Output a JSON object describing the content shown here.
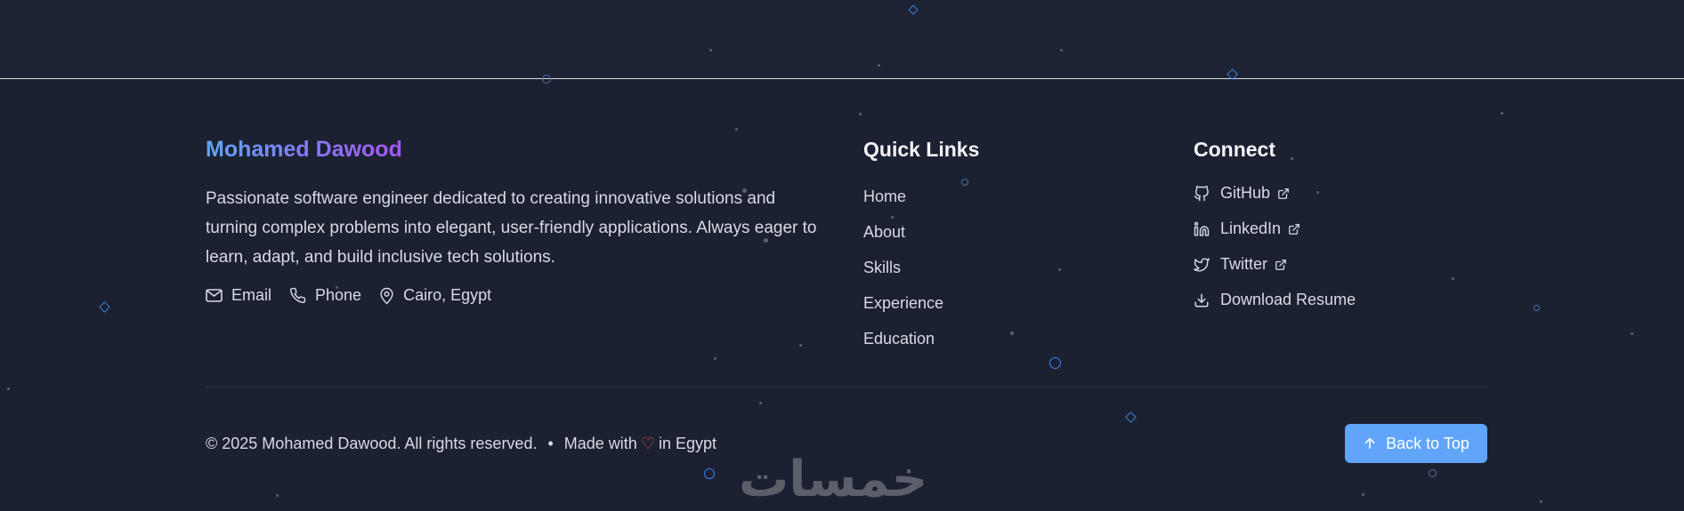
{
  "footer": {
    "brand": "Mohamed Dawood",
    "bio": "Passionate software engineer dedicated to creating innovative solutions and turning complex problems into elegant, user-friendly applications. Always eager to learn, adapt, and build inclusive tech solutions.",
    "contacts": [
      {
        "label": "Email",
        "icon": "mail-icon"
      },
      {
        "label": "Phone",
        "icon": "phone-icon"
      },
      {
        "label": "Cairo, Egypt",
        "icon": "map-pin-icon"
      }
    ],
    "quick_links": {
      "title": "Quick Links",
      "items": [
        "Home",
        "About",
        "Skills",
        "Experience",
        "Education"
      ]
    },
    "connect": {
      "title": "Connect",
      "items": [
        {
          "label": "GitHub",
          "icon": "github-icon",
          "external": true
        },
        {
          "label": "LinkedIn",
          "icon": "linkedin-icon",
          "external": true
        },
        {
          "label": "Twitter",
          "icon": "twitter-icon",
          "external": true
        },
        {
          "label": "Download Resume",
          "icon": "download-icon",
          "external": false
        }
      ]
    },
    "copyright": "© 2025 Mohamed Dawood. All rights reserved.",
    "separator": "•",
    "made_with_prefix": "Made with",
    "heart": "♡",
    "made_with_suffix": "in Egypt",
    "back_to_top": "Back to Top",
    "watermark": "خمسات"
  },
  "colors": {
    "background": "#1b2131",
    "accent": "#60a5fa",
    "gradient_start": "#60a5fa",
    "gradient_end": "#a855f7",
    "heart": "#ef4444"
  }
}
